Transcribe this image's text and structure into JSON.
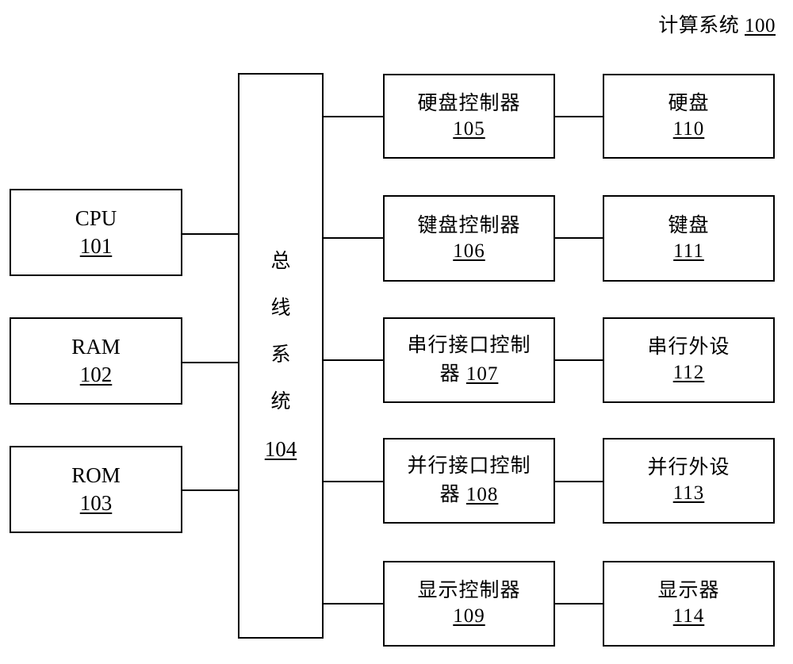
{
  "figure": {
    "title_text": "计算系统",
    "title_number": "100"
  },
  "blocks": {
    "cpu": {
      "label": "CPU",
      "number": "101"
    },
    "ram": {
      "label": "RAM",
      "number": "102"
    },
    "rom": {
      "label": "ROM",
      "number": "103"
    },
    "bus": {
      "chars": "总线系统",
      "number": "104"
    },
    "hdd_ctrl": {
      "label": "硬盘控制器",
      "number": "105"
    },
    "kbd_ctrl": {
      "label": "键盘控制器",
      "number": "106"
    },
    "serial_ctrl": {
      "label_line1": "串行接口控制",
      "label_line2": "器",
      "number": "107"
    },
    "parallel_ctrl": {
      "label_line1": "并行接口控制",
      "label_line2": "器",
      "number": "108"
    },
    "display_ctrl": {
      "label": "显示控制器",
      "number": "109"
    },
    "hdd": {
      "label": "硬盘",
      "number": "110"
    },
    "keyboard": {
      "label": "键盘",
      "number": "111"
    },
    "serial_dev": {
      "label": "串行外设",
      "number": "112"
    },
    "parallel_dev": {
      "label": "并行外设",
      "number": "113"
    },
    "display": {
      "label": "显示器",
      "number": "114"
    }
  },
  "bus_chars": [
    "总",
    "线",
    "系",
    "统"
  ],
  "colors": {
    "stroke": "#000000",
    "background": "#ffffff"
  }
}
